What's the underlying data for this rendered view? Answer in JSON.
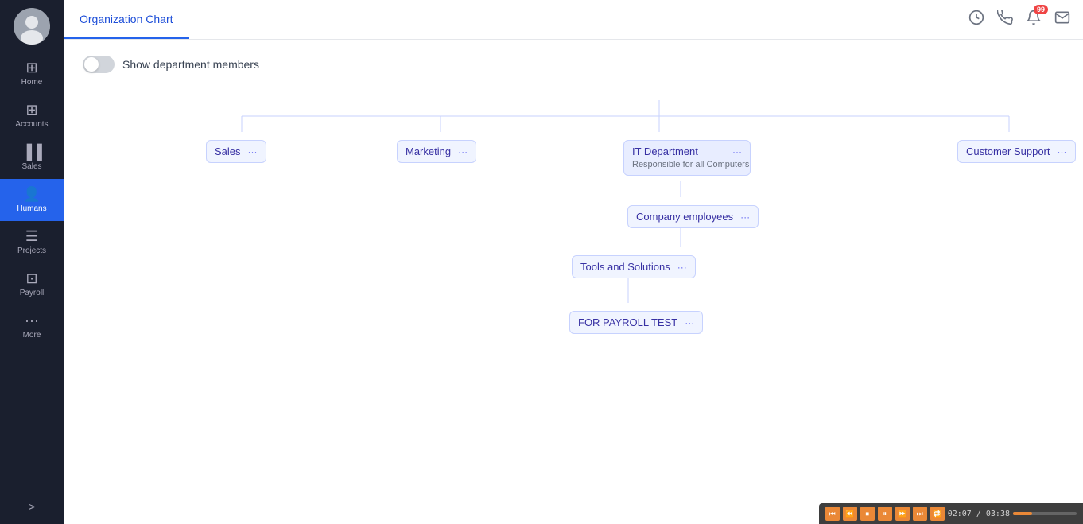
{
  "sidebar": {
    "items": [
      {
        "id": "home",
        "label": "Home",
        "icon": "⊞",
        "active": false
      },
      {
        "id": "accounts",
        "label": "Accounts",
        "icon": "⊞",
        "active": false
      },
      {
        "id": "sales",
        "label": "Sales",
        "icon": "📊",
        "active": false
      },
      {
        "id": "humans",
        "label": "Humans",
        "icon": "👤",
        "active": true
      },
      {
        "id": "projects",
        "label": "Projects",
        "icon": "≡",
        "active": false
      },
      {
        "id": "payroll",
        "label": "Payroll",
        "icon": "⊡",
        "active": false
      },
      {
        "id": "more",
        "label": "More",
        "icon": "•••",
        "active": false
      }
    ],
    "expand_label": ">"
  },
  "header": {
    "tab": "Organization Chart",
    "icons": {
      "history": "🕐",
      "phone": "📞",
      "bell": "🔔",
      "notification_count": "99",
      "mail": "✉"
    }
  },
  "toggle": {
    "label": "Show department members",
    "enabled": false
  },
  "org_chart": {
    "nodes": [
      {
        "id": "sales",
        "label": "Sales",
        "dots": "···"
      },
      {
        "id": "marketing",
        "label": "Marketing",
        "dots": "···"
      },
      {
        "id": "it_dept",
        "label": "IT Department",
        "desc": "Responsible for all Computers",
        "dots": "···",
        "highlighted": true
      },
      {
        "id": "customer_support",
        "label": "Customer Support",
        "dots": "···"
      },
      {
        "id": "company_employees",
        "label": "Company employees",
        "dots": "···"
      },
      {
        "id": "tools_solutions",
        "label": "Tools and Solutions",
        "dots": "···"
      },
      {
        "id": "payroll_test",
        "label": "FOR PAYROLL TEST",
        "dots": "···"
      }
    ]
  },
  "media_bar": {
    "time_elapsed": "02:07",
    "time_total": "03:38",
    "buttons": [
      "⏮",
      "⏪",
      "⏹",
      "⏸",
      "⏩",
      "⏭",
      "🔁"
    ]
  }
}
